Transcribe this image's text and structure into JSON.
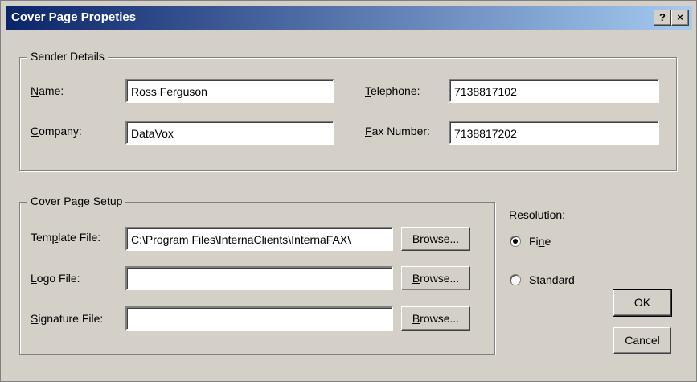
{
  "window": {
    "title": "Cover Page Propeties",
    "help_label": "?",
    "close_label": "×"
  },
  "sender": {
    "group_label": "Sender Details",
    "name": {
      "label_key": "N",
      "label_rest": "ame:",
      "value": "Ross  Ferguson"
    },
    "company": {
      "label_key": "C",
      "label_rest": "ompany:",
      "value": "DataVox"
    },
    "telephone": {
      "label_key": "T",
      "label_rest": "elephone:",
      "value": "7138817102"
    },
    "fax": {
      "label_key": "F",
      "label_rest": "ax Number:",
      "value": "7138817202"
    }
  },
  "setup": {
    "group_label": "Cover Page Setup",
    "template": {
      "label_pre": "Tem",
      "label_key": "p",
      "label_rest": "late File:",
      "value": "C:\\Program Files\\InternaClients\\InternaFAX\\"
    },
    "logo": {
      "label_key": "L",
      "label_rest": "ogo File:",
      "value": ""
    },
    "signature": {
      "label_key": "S",
      "label_rest": "ignature File:",
      "value": ""
    },
    "browse_key": "B",
    "browse_rest": "rowse..."
  },
  "resolution": {
    "label": "Resolution:",
    "fine_pre": "Fi",
    "fine_key": "n",
    "fine_rest": "e",
    "standard_label": "Standard",
    "selected": "Fine"
  },
  "buttons": {
    "ok": "OK",
    "cancel": "Cancel"
  }
}
